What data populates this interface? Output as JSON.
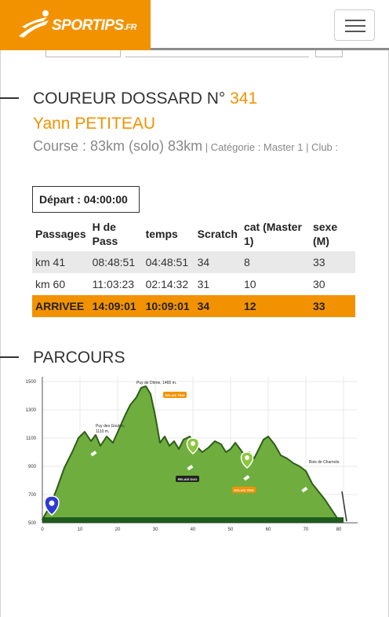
{
  "header": {
    "logo_text": "SPORTIPS",
    "logo_suffix": ".FR",
    "menu_icon": "hamburger-menu-icon"
  },
  "runner": {
    "heading_prefix": "COUREUR DOSSARD N°",
    "bib_number": "341",
    "name": "Yann PETITEAU",
    "course_prefix": "Course : 83km (solo) 83km",
    "course_meta": " | Catégorie : Master 1 | Club :"
  },
  "depart": "Départ : 04:00:00",
  "passages_table": {
    "headers": [
      "Passages",
      "H de Pass",
      "temps",
      "Scratch",
      "cat (Master 1)",
      "sexe (M)"
    ],
    "rows": [
      [
        "km 41",
        "08:48:51",
        "04:48:51",
        "34",
        "8",
        "33"
      ],
      [
        "km 60",
        "11:03:23",
        "02:14:32",
        "31",
        "10",
        "30"
      ],
      [
        "ARRIVEE",
        "14:09:01",
        "10:09:01",
        "34",
        "12",
        "33"
      ]
    ]
  },
  "parcours": {
    "title": "PARCOURS",
    "y_ticks": [
      "1500",
      "1300",
      "1100",
      "900",
      "700",
      "500"
    ],
    "x_ticks": [
      "0",
      "10",
      "20",
      "30",
      "40",
      "50",
      "60",
      "70",
      "80"
    ],
    "annotations": {
      "summit": "Puy de Dôme, 1465 m.",
      "goutes": "Puy des Goutes,",
      "goutes_alt": "1110 m.",
      "charnots": "Bois de Charnots",
      "relais_1": "RELAIS TRIO",
      "relais_2": "RELAIS DUO",
      "relais_3": "RELAIS TRIO"
    },
    "colors": {
      "fill": "#6fae3e",
      "ridge": "#2e5e18",
      "ground": "#1f5a1f",
      "start_marker": "#2d3ad1",
      "waypoint": "#8dc63f",
      "relay_badge": "#f39200"
    }
  }
}
